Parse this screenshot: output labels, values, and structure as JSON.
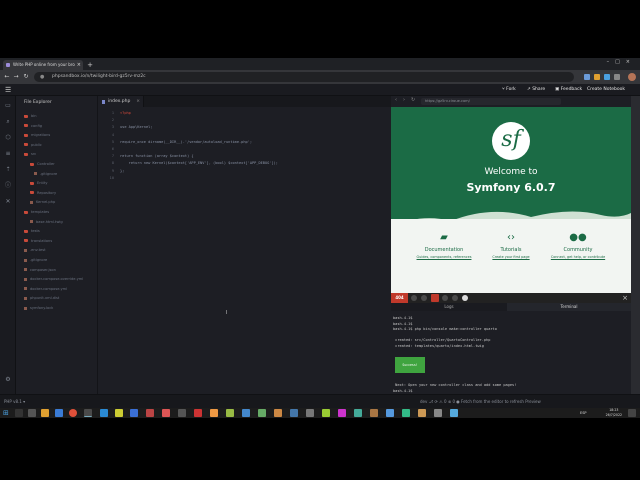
{
  "browser": {
    "tab_title": "Write PHP online from your bro",
    "url": "phpsandbox.io/n/twilight-bird-gz5rv-mz2c"
  },
  "app": {
    "fork": "Fork",
    "share": "Share",
    "feedback": "Feedback",
    "create_notebook": "Create Notebook"
  },
  "explorer": {
    "title": "File Explorer",
    "items": [
      {
        "label": "bin",
        "type": "folder"
      },
      {
        "label": "config",
        "type": "folder"
      },
      {
        "label": "migrations",
        "type": "folder"
      },
      {
        "label": "public",
        "type": "folder"
      },
      {
        "label": "src",
        "type": "folder"
      },
      {
        "label": "Controller",
        "type": "folder"
      },
      {
        "label": ".gitignore",
        "type": "file"
      },
      {
        "label": "Entity",
        "type": "folder"
      },
      {
        "label": "Repository",
        "type": "folder"
      },
      {
        "label": "Kernel.php",
        "type": "file"
      },
      {
        "label": "templates",
        "type": "folder"
      },
      {
        "label": "base.html.twig",
        "type": "file"
      },
      {
        "label": "tests",
        "type": "folder"
      },
      {
        "label": "translations",
        "type": "folder"
      },
      {
        "label": ".env.test",
        "type": "file"
      },
      {
        "label": ".gitignore",
        "type": "file"
      },
      {
        "label": "composer.json",
        "type": "file"
      },
      {
        "label": "docker-compose.override.yml",
        "type": "file"
      },
      {
        "label": "docker-compose.yml",
        "type": "file"
      },
      {
        "label": "phpunit.xml.dist",
        "type": "file"
      },
      {
        "label": "symfony.lock",
        "type": "file"
      }
    ]
  },
  "editor": {
    "tab": "index.php",
    "line_numbers": [
      "1",
      "2",
      "3",
      "4",
      "5",
      "6",
      "7",
      "8",
      "9",
      "10"
    ],
    "lines": [
      "<?php",
      "",
      "use App\\Kernel;",
      "",
      "require_once dirname(__DIR__).'/vendor/autoload_runtime.php';",
      "",
      "return function (array $context) {",
      "    return new Kernel($context['APP_ENV'], (bool) $context['APP_DEBUG']);",
      "};",
      ""
    ]
  },
  "preview": {
    "url": "https://gz5rv.ciroue.com/",
    "logo": "sf",
    "welcome": "Welcome to",
    "version": "Symfony 6.0.7",
    "cards": [
      {
        "icon": "book-icon",
        "title": "Documentation",
        "sub": "Guides, components, references"
      },
      {
        "icon": "code-icon",
        "title": "Tutorials",
        "sub": "Create your first page"
      },
      {
        "icon": "people-icon",
        "title": "Community",
        "sub": "Connect, get help, or contribute"
      }
    ],
    "status": "404",
    "logs_tab": "Logs",
    "terminal_tab": "Terminal"
  },
  "terminal": {
    "lines": [
      "bash-4.1$",
      "bash-4.1$",
      "bash-4.1$ php bin/console make:controller quarto",
      "",
      " created: src/Controller/QuartoController.php",
      " created: templates/quarto/index.html.twig",
      "",
      "",
      "",
      "",
      "",
      "",
      " Next: Open your new controller class and add some pages!",
      "bash-4.1$ "
    ],
    "success": "Success!"
  },
  "statusbar": {
    "php": "PHP v8.1 ▾",
    "right": "dev ⎇  ⟳  ⚠ 0  ⊗ 0  ● Fetch from the editor to refresh Preview"
  },
  "taskbar": {
    "lang": "ESP",
    "time": "18:23",
    "date": "26/7/2022"
  }
}
